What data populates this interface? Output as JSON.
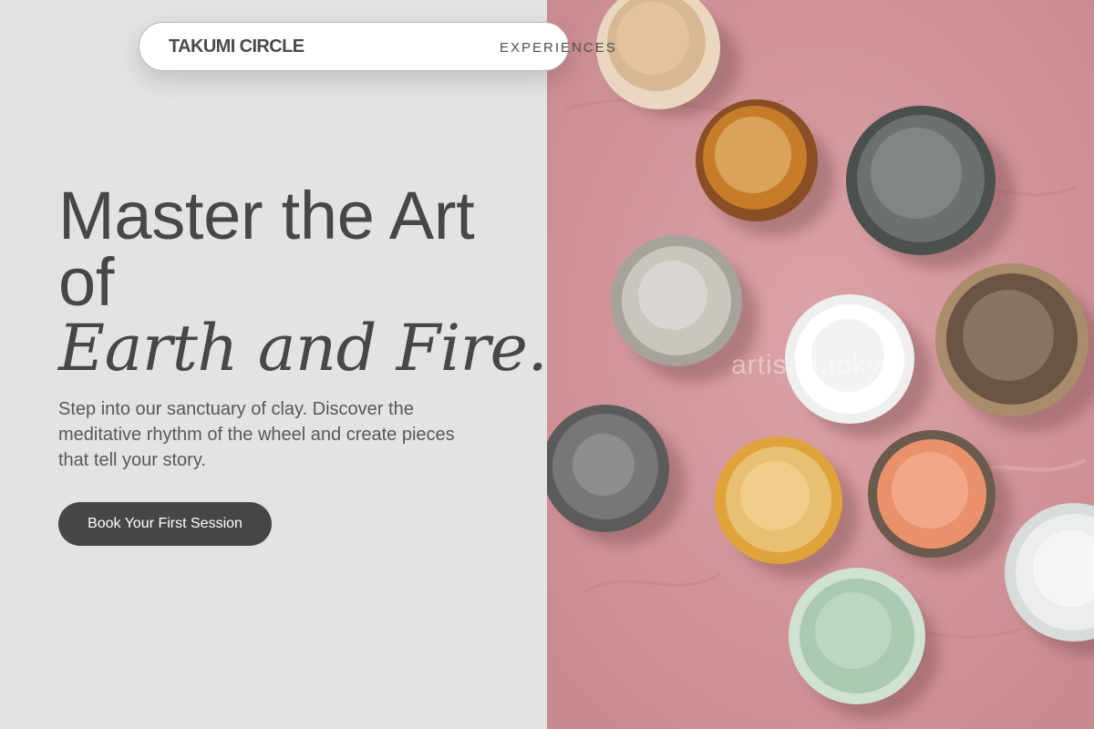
{
  "nav": {
    "brand": "TAKUMI CIRCLE",
    "links": [
      "EXPERIENCES"
    ]
  },
  "hero": {
    "title_lines": [
      "Master the Art",
      "of"
    ],
    "title_accent": "Earth and Fire.",
    "description": "Step into our sanctuary of clay. Discover the meditative rhythm of the wheel and create pieces that tell your story.",
    "cta_label": "Book Your First Session"
  },
  "photo": {
    "watermark": "artisan.tokyo",
    "subject": "ceramic-bowls-on-pink-surface"
  },
  "colors": {
    "page_background": "#e5e3e1",
    "text_dark": "#474747",
    "text_body": "#55585e",
    "button": "#464646",
    "button_text": "#ffffff",
    "photo_background": "#d59b9f"
  }
}
